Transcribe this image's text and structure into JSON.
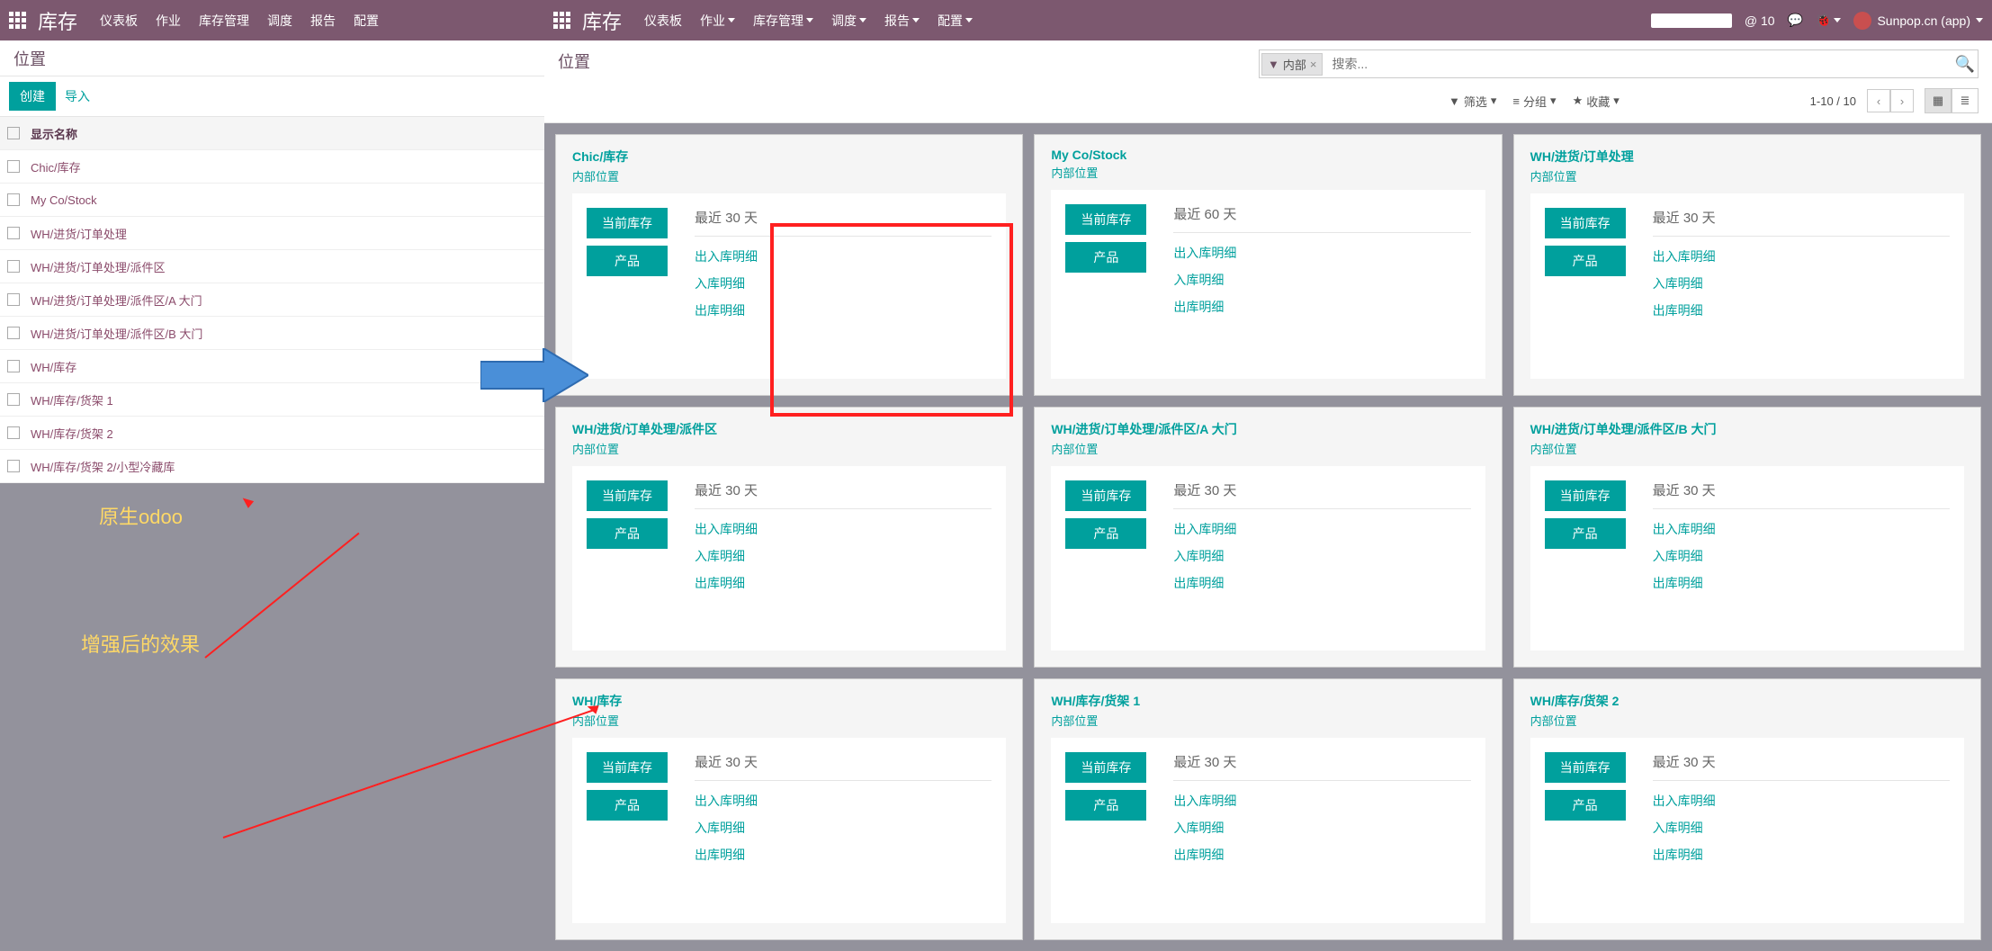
{
  "colors": {
    "accent": "#00a09d",
    "brandbar": "#7c586f"
  },
  "left": {
    "brand": "库存",
    "nav": [
      "仪表板",
      "作业",
      "库存管理",
      "调度",
      "报告",
      "配置"
    ],
    "breadcrumb": "位置",
    "create": "创建",
    "import": "导入",
    "header": "显示名称",
    "rows": [
      "Chic/库存",
      "My Co/Stock",
      "WH/进货/订单处理",
      "WH/进货/订单处理/派件区",
      "WH/进货/订单处理/派件区/A 大门",
      "WH/进货/订单处理/派件区/B 大门",
      "WH/库存",
      "WH/库存/货架 1",
      "WH/库存/货架 2",
      "WH/库存/货架 2/小型冷藏库"
    ],
    "annot1": "原生odoo",
    "annot2": "增强后的效果"
  },
  "right": {
    "brand": "库存",
    "nav": [
      "仪表板",
      "作业",
      "库存管理",
      "调度",
      "报告",
      "配置"
    ],
    "msg_count": "@ 10",
    "user": "Sunpop.cn (app)",
    "breadcrumb": "位置",
    "tag": "内部",
    "search_ph": "搜索...",
    "filter": "筛选",
    "group": "分组",
    "fav": "收藏",
    "pager": "1-10 / 10",
    "card_sub": "内部位置",
    "btn_stock": "当前库存",
    "btn_prod": "产品",
    "link_io": "出入库明细",
    "link_in": "入库明细",
    "link_out": "出库明细",
    "cards": [
      {
        "title": "Chic/库存",
        "days": "最近 30 天"
      },
      {
        "title": "My Co/Stock",
        "days": "最近 60 天"
      },
      {
        "title": "WH/进货/订单处理",
        "days": "最近 30 天"
      },
      {
        "title": "WH/进货/订单处理/派件区",
        "days": "最近 30 天"
      },
      {
        "title": "WH/进货/订单处理/派件区/A 大门",
        "days": "最近 30 天"
      },
      {
        "title": "WH/进货/订单处理/派件区/B 大门",
        "days": "最近 30 天"
      },
      {
        "title": "WH/库存",
        "days": "最近 30 天"
      },
      {
        "title": "WH/库存/货架 1",
        "days": "最近 30 天"
      },
      {
        "title": "WH/库存/货架 2",
        "days": "最近 30 天"
      }
    ]
  }
}
